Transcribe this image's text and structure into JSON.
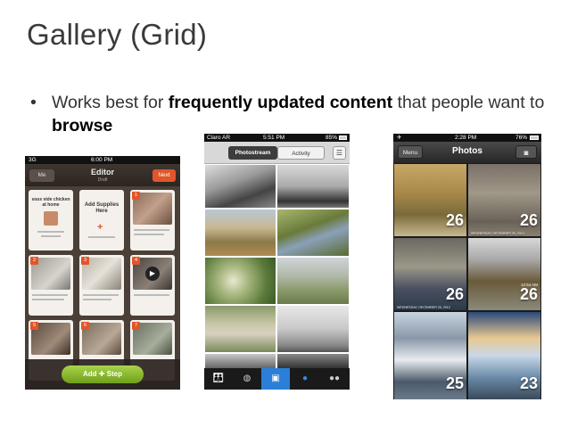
{
  "slide": {
    "title": "Gallery (Grid)",
    "bullet_1": "Works best for ",
    "bullet_bold_1": "frequently updated content",
    "bullet_2": " that people want to ",
    "bullet_bold_2": "browse"
  },
  "phone1": {
    "status": {
      "carrier": "3G",
      "time": "6:00 PM"
    },
    "nav": {
      "back": "Me",
      "title": "Editor",
      "subtitle": "Draft",
      "next": "Next"
    },
    "cards": [
      {
        "title": "sous vide chicken at home",
        "num": ""
      },
      {
        "title": "Add Supplies Here",
        "num": ""
      },
      {
        "title": "",
        "num": "1"
      },
      {
        "title": "",
        "num": "2"
      },
      {
        "title": "",
        "num": "3"
      },
      {
        "title": "",
        "num": "4"
      },
      {
        "title": "",
        "num": "5"
      },
      {
        "title": "",
        "num": "6"
      },
      {
        "title": "",
        "num": "7"
      }
    ],
    "add_button": "Add ✚ Step"
  },
  "phone2": {
    "status": {
      "carrier": "Claro AR",
      "time": "5:51 PM",
      "battery": "85%"
    },
    "tabs": [
      "Photostream",
      "Activity"
    ],
    "list_icon": "list-icon",
    "tabbar": [
      "people-icon",
      "globe-icon",
      "camera-icon",
      "person-icon",
      "dots-icon"
    ]
  },
  "phone3": {
    "status": {
      "time": "2:28 PM",
      "battery": "76%"
    },
    "nav": {
      "menu": "Menu",
      "title": "Photos",
      "camera": "camera-icon"
    },
    "tiles": [
      {
        "day": "26",
        "date": "",
        "time": ""
      },
      {
        "day": "26",
        "date": "WEDNESDAY, DECEMBER 26, 2012",
        "time": ""
      },
      {
        "day": "26",
        "date": "WEDNESDAY, DECEMBER 26, 2012",
        "time": ""
      },
      {
        "day": "26",
        "date": "",
        "time": "12:54 AM"
      },
      {
        "day": "25",
        "date": "",
        "time": ""
      },
      {
        "day": "23",
        "date": "",
        "time": ""
      }
    ]
  }
}
